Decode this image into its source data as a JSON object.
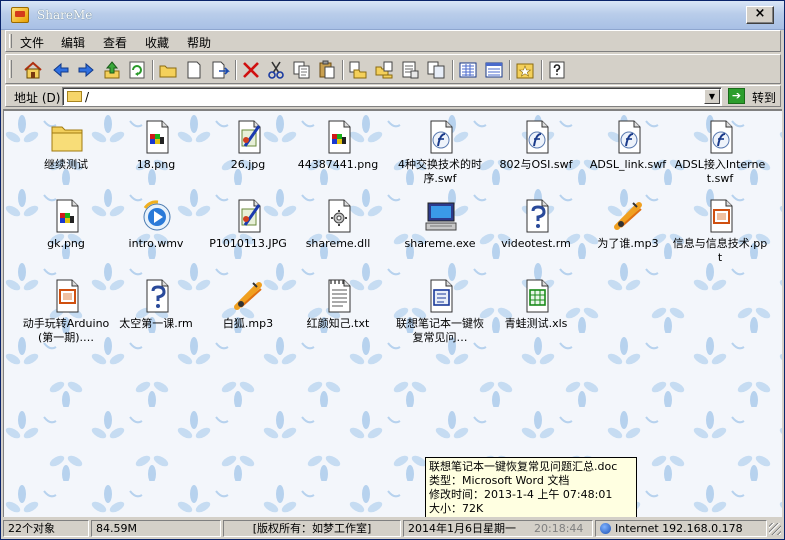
{
  "window": {
    "title": "ShareMe",
    "close_glyph": "×"
  },
  "menu": [
    "文件",
    "编辑",
    "查看",
    "收藏",
    "帮助"
  ],
  "toolbar": [
    "home-icon",
    "back-icon",
    "forward-icon",
    "up-icon",
    "refresh-icon",
    "new-folder-icon",
    "new-file-icon",
    "rename-icon",
    "delete-icon",
    "cut-icon",
    "copy-icon",
    "paste-icon",
    "copy-to-icon",
    "move-to-icon",
    "properties-icon",
    "duplicate-icon",
    "large-icons-view-icon",
    "details-view-icon",
    "favorites-icon",
    "help-icon"
  ],
  "address": {
    "label": "地址 (D)",
    "value": "/",
    "go_label": "转到",
    "go_icon": "go-arrow-icon"
  },
  "files": [
    {
      "name": "继续测试",
      "icon": "folder"
    },
    {
      "name": "18.png",
      "icon": "image"
    },
    {
      "name": "26.jpg",
      "icon": "jpg"
    },
    {
      "name": "44387441.png",
      "icon": "image"
    },
    {
      "name": "4种交换技术的时序.swf",
      "icon": "swf"
    },
    {
      "name": "802与OSI.swf",
      "icon": "swf"
    },
    {
      "name": "ADSL_link.swf",
      "icon": "swf"
    },
    {
      "name": "ADSL接入Internet.swf",
      "icon": "swf"
    },
    {
      "name": "gk.png",
      "icon": "image"
    },
    {
      "name": "intro.wmv",
      "icon": "wmv"
    },
    {
      "name": "P1010113.JPG",
      "icon": "jpg"
    },
    {
      "name": "shareme.dll",
      "icon": "dll"
    },
    {
      "name": "shareme.exe",
      "icon": "exe"
    },
    {
      "name": "videotest.rm",
      "icon": "rm"
    },
    {
      "name": "为了谁.mp3",
      "icon": "mp3"
    },
    {
      "name": "信息与信息技术.ppt",
      "icon": "ppt"
    },
    {
      "name": "动手玩转Arduino(第一期).…",
      "icon": "ppt"
    },
    {
      "name": "太空第一课.rm",
      "icon": "rm"
    },
    {
      "name": "白狐.mp3",
      "icon": "mp3"
    },
    {
      "name": "红颜知己.txt",
      "icon": "txt"
    },
    {
      "name": "联想笔记本一键恢复常见问…",
      "icon": "doc"
    },
    {
      "name": "青蛙测试.xls",
      "icon": "xls"
    }
  ],
  "tooltip": {
    "lines": [
      "联想笔记本一键恢复常见问题汇总.doc",
      "类型：Microsoft Word 文档",
      "修改时间：2013-1-4 上午 07:48:01",
      "大小：72K"
    ]
  },
  "status": {
    "count": "22个对象",
    "size": "84.59M",
    "copyright": "[版权所有：如梦工作室]",
    "date": "2014年1月6日星期一",
    "time": "20:18:44",
    "network": "Internet 192.168.0.178"
  }
}
